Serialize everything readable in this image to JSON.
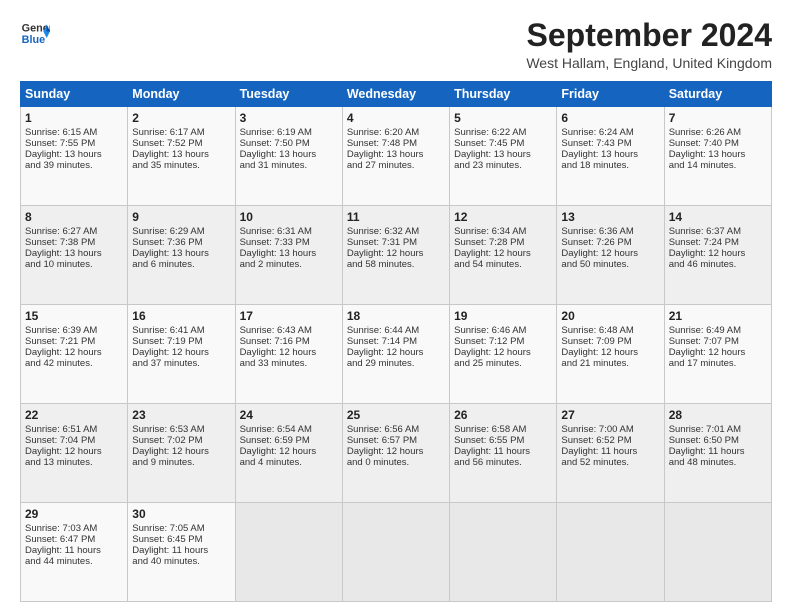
{
  "header": {
    "logo_general": "General",
    "logo_blue": "Blue",
    "month_title": "September 2024",
    "location": "West Hallam, England, United Kingdom"
  },
  "weekdays": [
    "Sunday",
    "Monday",
    "Tuesday",
    "Wednesday",
    "Thursday",
    "Friday",
    "Saturday"
  ],
  "weeks": [
    [
      {
        "day": "1",
        "sunrise": "6:15 AM",
        "sunset": "7:55 PM",
        "daylight": "13 hours and 39 minutes."
      },
      {
        "day": "2",
        "sunrise": "6:17 AM",
        "sunset": "7:52 PM",
        "daylight": "13 hours and 35 minutes."
      },
      {
        "day": "3",
        "sunrise": "6:19 AM",
        "sunset": "7:50 PM",
        "daylight": "13 hours and 31 minutes."
      },
      {
        "day": "4",
        "sunrise": "6:20 AM",
        "sunset": "7:48 PM",
        "daylight": "13 hours and 27 minutes."
      },
      {
        "day": "5",
        "sunrise": "6:22 AM",
        "sunset": "7:45 PM",
        "daylight": "13 hours and 23 minutes."
      },
      {
        "day": "6",
        "sunrise": "6:24 AM",
        "sunset": "7:43 PM",
        "daylight": "13 hours and 18 minutes."
      },
      {
        "day": "7",
        "sunrise": "6:26 AM",
        "sunset": "7:40 PM",
        "daylight": "13 hours and 14 minutes."
      }
    ],
    [
      {
        "day": "8",
        "sunrise": "6:27 AM",
        "sunset": "7:38 PM",
        "daylight": "13 hours and 10 minutes."
      },
      {
        "day": "9",
        "sunrise": "6:29 AM",
        "sunset": "7:36 PM",
        "daylight": "13 hours and 6 minutes."
      },
      {
        "day": "10",
        "sunrise": "6:31 AM",
        "sunset": "7:33 PM",
        "daylight": "13 hours and 2 minutes."
      },
      {
        "day": "11",
        "sunrise": "6:32 AM",
        "sunset": "7:31 PM",
        "daylight": "12 hours and 58 minutes."
      },
      {
        "day": "12",
        "sunrise": "6:34 AM",
        "sunset": "7:28 PM",
        "daylight": "12 hours and 54 minutes."
      },
      {
        "day": "13",
        "sunrise": "6:36 AM",
        "sunset": "7:26 PM",
        "daylight": "12 hours and 50 minutes."
      },
      {
        "day": "14",
        "sunrise": "6:37 AM",
        "sunset": "7:24 PM",
        "daylight": "12 hours and 46 minutes."
      }
    ],
    [
      {
        "day": "15",
        "sunrise": "6:39 AM",
        "sunset": "7:21 PM",
        "daylight": "12 hours and 42 minutes."
      },
      {
        "day": "16",
        "sunrise": "6:41 AM",
        "sunset": "7:19 PM",
        "daylight": "12 hours and 37 minutes."
      },
      {
        "day": "17",
        "sunrise": "6:43 AM",
        "sunset": "7:16 PM",
        "daylight": "12 hours and 33 minutes."
      },
      {
        "day": "18",
        "sunrise": "6:44 AM",
        "sunset": "7:14 PM",
        "daylight": "12 hours and 29 minutes."
      },
      {
        "day": "19",
        "sunrise": "6:46 AM",
        "sunset": "7:12 PM",
        "daylight": "12 hours and 25 minutes."
      },
      {
        "day": "20",
        "sunrise": "6:48 AM",
        "sunset": "7:09 PM",
        "daylight": "12 hours and 21 minutes."
      },
      {
        "day": "21",
        "sunrise": "6:49 AM",
        "sunset": "7:07 PM",
        "daylight": "12 hours and 17 minutes."
      }
    ],
    [
      {
        "day": "22",
        "sunrise": "6:51 AM",
        "sunset": "7:04 PM",
        "daylight": "12 hours and 13 minutes."
      },
      {
        "day": "23",
        "sunrise": "6:53 AM",
        "sunset": "7:02 PM",
        "daylight": "12 hours and 9 minutes."
      },
      {
        "day": "24",
        "sunrise": "6:54 AM",
        "sunset": "6:59 PM",
        "daylight": "12 hours and 4 minutes."
      },
      {
        "day": "25",
        "sunrise": "6:56 AM",
        "sunset": "6:57 PM",
        "daylight": "12 hours and 0 minutes."
      },
      {
        "day": "26",
        "sunrise": "6:58 AM",
        "sunset": "6:55 PM",
        "daylight": "11 hours and 56 minutes."
      },
      {
        "day": "27",
        "sunrise": "7:00 AM",
        "sunset": "6:52 PM",
        "daylight": "11 hours and 52 minutes."
      },
      {
        "day": "28",
        "sunrise": "7:01 AM",
        "sunset": "6:50 PM",
        "daylight": "11 hours and 48 minutes."
      }
    ],
    [
      {
        "day": "29",
        "sunrise": "7:03 AM",
        "sunset": "6:47 PM",
        "daylight": "11 hours and 44 minutes."
      },
      {
        "day": "30",
        "sunrise": "7:05 AM",
        "sunset": "6:45 PM",
        "daylight": "11 hours and 40 minutes."
      },
      null,
      null,
      null,
      null,
      null
    ]
  ]
}
